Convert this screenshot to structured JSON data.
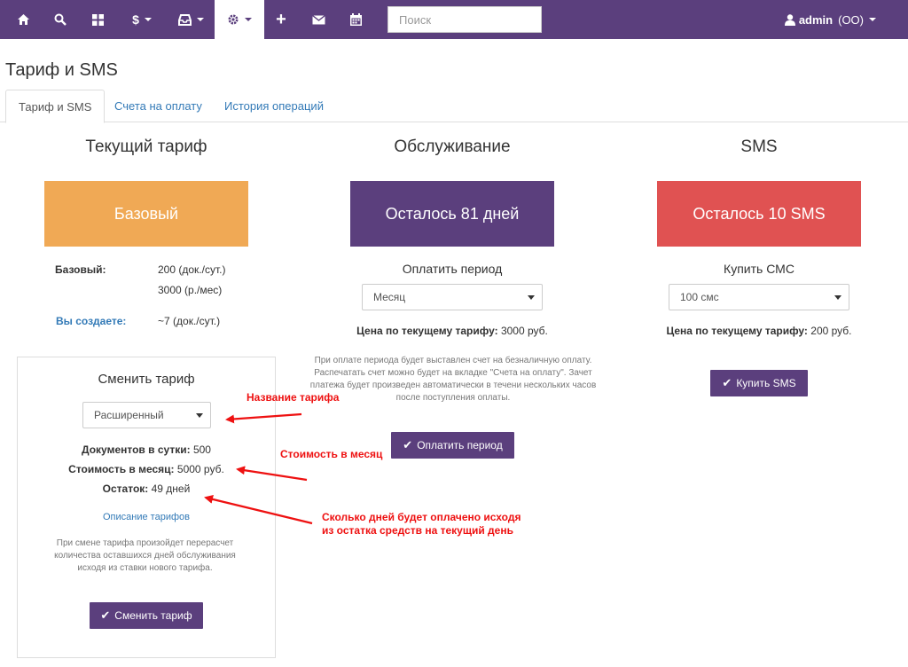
{
  "nav": {
    "search_placeholder": "Поиск",
    "user_name": "admin",
    "user_org": "(ОО)",
    "icons": [
      "home-icon",
      "search-icon",
      "grid-icon",
      "dollar-icon",
      "inbox-icon",
      "gear-icon",
      "plus-icon",
      "envelope-icon",
      "calendar-icon"
    ]
  },
  "page": {
    "title": "Тариф и SMS",
    "tabs": [
      {
        "label": "Тариф и SMS",
        "active": true
      },
      {
        "label": "Счета на оплату",
        "active": false
      },
      {
        "label": "История операций",
        "active": false
      }
    ]
  },
  "tariff": {
    "title": "Текущий тариф",
    "box_label": "Базовый",
    "plan_label": "Базовый:",
    "plan_docs": "200 (док./сут.)",
    "plan_price": "3000 (р./мес)",
    "creating_label": "Вы создаете:",
    "creating_value": "~7 (док./сут.)"
  },
  "change": {
    "title": "Сменить тариф",
    "selected": "Расширенный",
    "docs_label": "Документов в сутки:",
    "docs_value": "500",
    "cost_label": "Стоимость в месяц:",
    "cost_value": "5000 руб.",
    "rest_label": "Остаток:",
    "rest_value": "49 дней",
    "link": "Описание тарифов",
    "note": "При смене тарифа произойдет перерасчет количества оставшихся дней обслуживания исходя из ставки нового тарифа.",
    "button": "Сменить тариф"
  },
  "service": {
    "title": "Обслуживание",
    "box_label": "Осталось 81 дней",
    "pay_title": "Оплатить период",
    "selected": "Месяц",
    "price_label": "Цена по текущему тарифу:",
    "price_value": "3000 руб.",
    "note": "При оплате периода будет выставлен счет на безналичную оплату. Распечатать счет можно будет на вкладке \"Счета на оплату\". Зачет платежа будет произведен автоматически в течени нескольких часов после поступления оплаты.",
    "button": "Оплатить период"
  },
  "sms": {
    "title": "SMS",
    "box_label": "Осталось 10 SMS",
    "buy_title": "Купить СМС",
    "selected": "100 смс",
    "price_label": "Цена по текущему тарифу:",
    "price_value": "200 руб.",
    "button": "Купить SMS"
  },
  "annotations": {
    "name": "Название тарифа",
    "cost": "Стоимость в месяц",
    "days_line1": "Сколько дней будет оплачено исходя",
    "days_line2": "из остатка средств на текущий день"
  },
  "colors": {
    "brand": "#5b3f7d",
    "orange": "#f0a955",
    "red": "#e05252",
    "annotation": "#ee1111",
    "link": "#337ab7"
  }
}
